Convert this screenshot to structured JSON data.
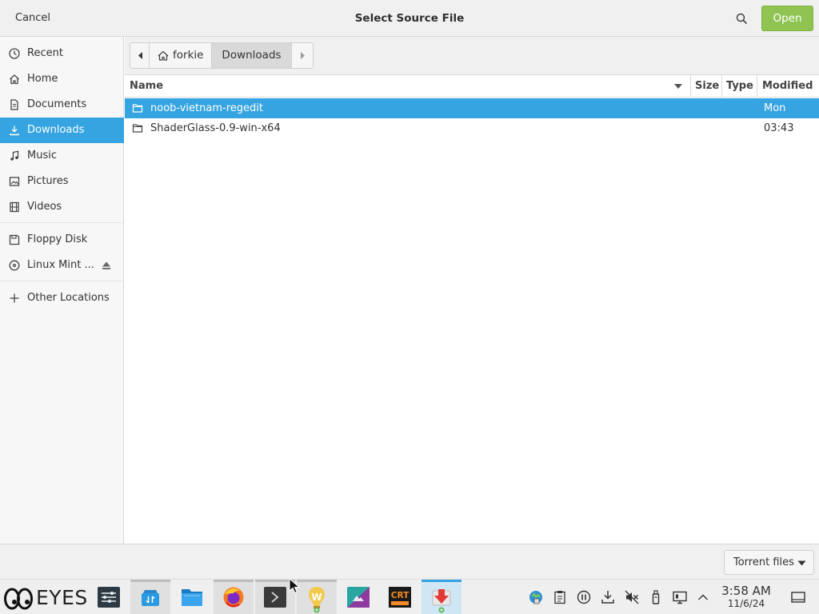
{
  "header": {
    "cancel_label": "Cancel",
    "title": "Select Source File",
    "open_label": "Open"
  },
  "sidebar": {
    "items": [
      {
        "label": "Recent",
        "icon": "clock-icon"
      },
      {
        "label": "Home",
        "icon": "home-icon"
      },
      {
        "label": "Documents",
        "icon": "document-icon"
      },
      {
        "label": "Downloads",
        "icon": "download-icon",
        "active": true
      },
      {
        "label": "Music",
        "icon": "music-note-icon"
      },
      {
        "label": "Pictures",
        "icon": "picture-icon"
      },
      {
        "label": "Videos",
        "icon": "film-icon"
      },
      {
        "label": "Floppy Disk",
        "icon": "floppy-disk-icon"
      },
      {
        "label": "Linux Mint ...",
        "icon": "optical-disc-icon"
      },
      {
        "label": "Other Locations",
        "icon": "plus-icon"
      }
    ]
  },
  "pathbar": {
    "home_label": "forkie",
    "current_label": "Downloads"
  },
  "filelist": {
    "columns": {
      "name": "Name",
      "size": "Size",
      "type": "Type",
      "modified": "Modified"
    },
    "rows": [
      {
        "name": "noob-vietnam-regedit",
        "modified": "Mon",
        "selected": true
      },
      {
        "name": "ShaderGlass-0.9-win-x64",
        "modified": "03:43"
      }
    ]
  },
  "footer": {
    "filter_label": "Torrent files"
  },
  "taskbar": {
    "start_label": "EYES",
    "apps": [
      "system-settings-icon",
      "store-icon",
      "file-manager-icon",
      "firefox-icon",
      "terminal-icon",
      "wine-icon",
      "image-editor-icon",
      "crt-app-icon",
      "torrent-downloader-icon"
    ],
    "crt_text": "CRT",
    "clock_time": "3:58 AM",
    "clock_date": "11/6/24"
  },
  "colors": {
    "accent": "#35a4e0",
    "open_button": "#8fc452"
  }
}
